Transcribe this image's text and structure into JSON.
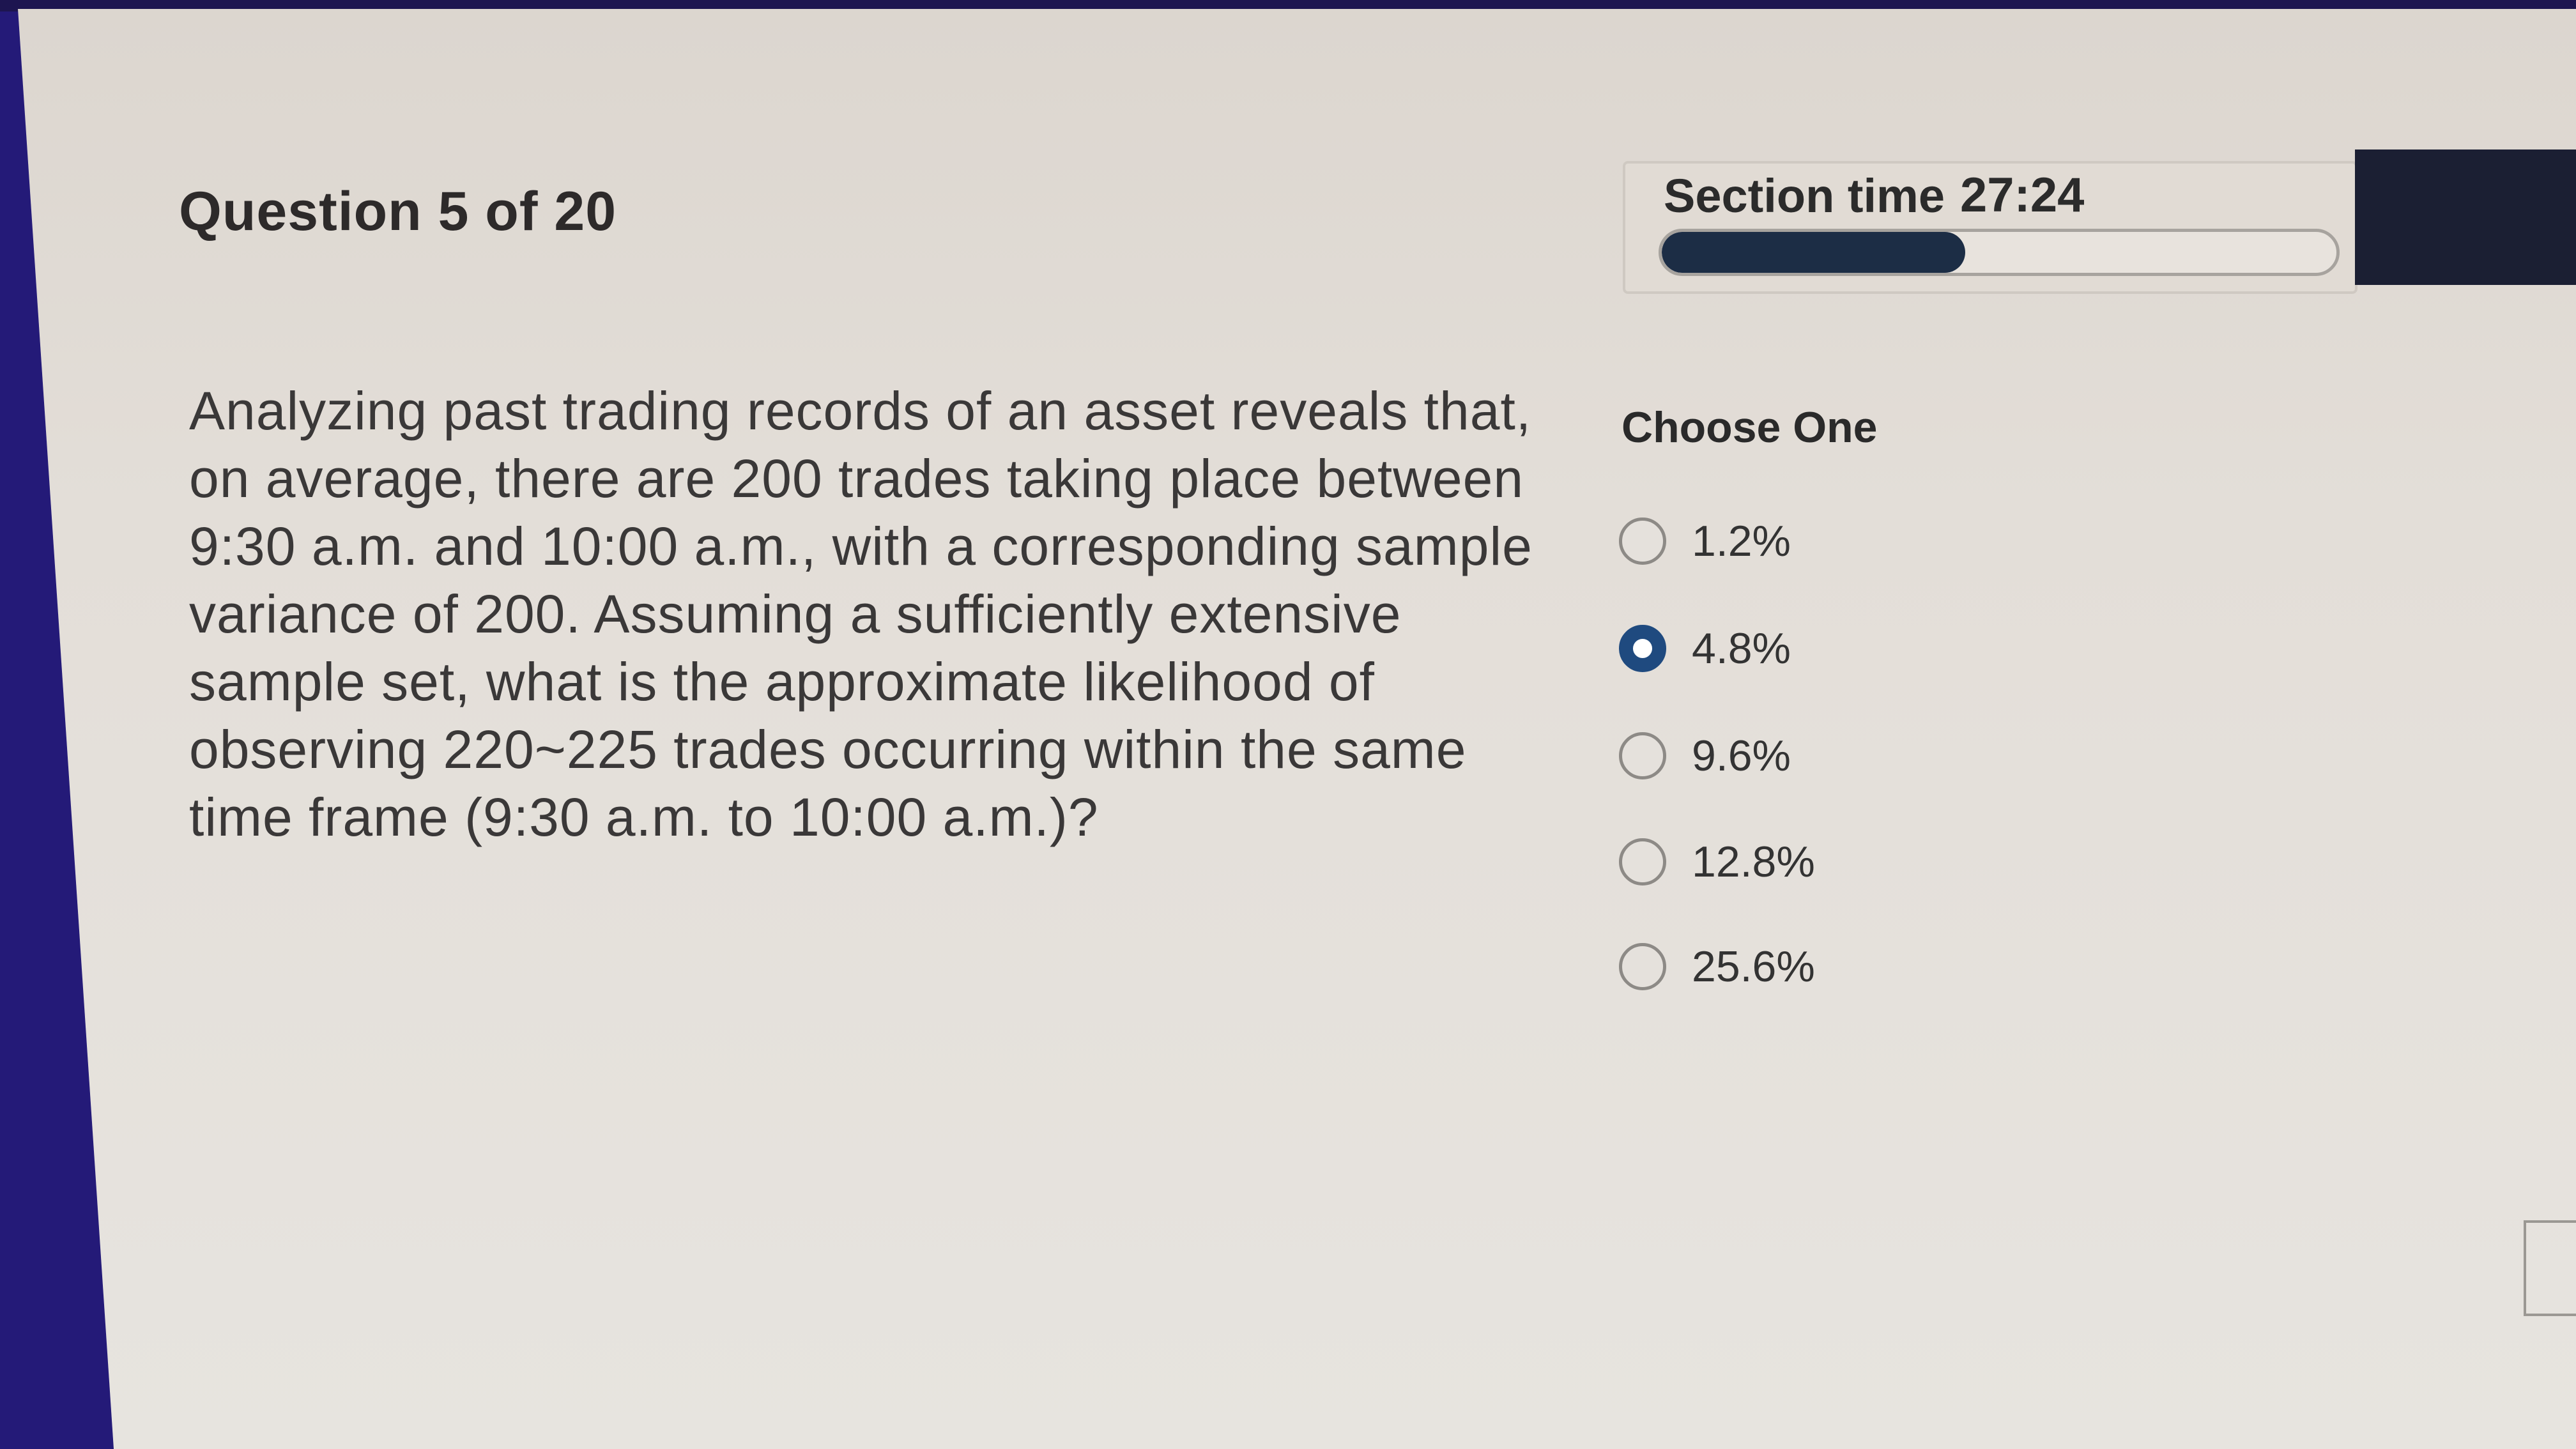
{
  "header": {
    "question_counter": "Question 5 of 20"
  },
  "timer": {
    "label": "Section time",
    "value": "27:24",
    "progress_fraction": 0.45
  },
  "question": {
    "text": "Analyzing past trading records of an asset reveals that, on average, there are 200 trades taking place between 9:30 a.m. and 10:00 a.m., with a corresponding sample variance of 200. Assuming a sufficiently extensive sample set, what is the approximate likelihood of observing 220~225 trades occurring within the same time frame (9:30 a.m. to 10:00 a.m.)?"
  },
  "answers": {
    "prompt": "Choose One",
    "options": [
      {
        "label": "1.2%",
        "selected": false
      },
      {
        "label": "4.8%",
        "selected": true
      },
      {
        "label": "9.6%",
        "selected": false
      },
      {
        "label": "12.8%",
        "selected": false
      },
      {
        "label": "25.6%",
        "selected": false
      }
    ]
  },
  "colors": {
    "selected_radio": "#1f4a7f",
    "progress_fill": "#1c2d45"
  }
}
